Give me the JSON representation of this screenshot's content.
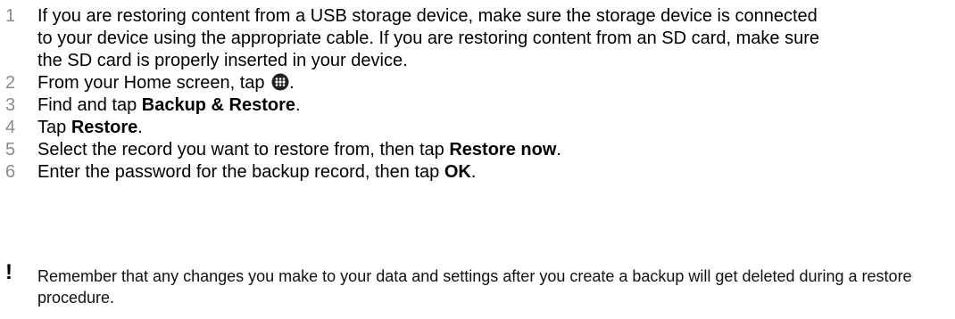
{
  "steps": [
    {
      "number": "1",
      "text": "If you are restoring content from a USB storage device, make sure the storage device is connected to your device using the appropriate cable. If you are restoring content from an SD card, make sure the SD card is properly inserted in your device."
    },
    {
      "number": "2",
      "prefix": "From your Home screen, tap ",
      "icon": "apps-grid-icon",
      "suffix": "."
    },
    {
      "number": "3",
      "prefix": "Find and tap ",
      "bold": "Backup & Restore",
      "suffix": "."
    },
    {
      "number": "4",
      "prefix": "Tap ",
      "bold": "Restore",
      "suffix": "."
    },
    {
      "number": "5",
      "prefix": "Select the record you want to restore from, then tap ",
      "bold": "Restore now",
      "suffix": "."
    },
    {
      "number": "6",
      "prefix": "Enter the password for the backup record, then tap ",
      "bold": "OK",
      "suffix": "."
    }
  ],
  "note": {
    "mark": "!",
    "text": "Remember that any changes you make to your data and settings after you create a backup will get deleted during a restore procedure."
  },
  "colors": {
    "step_number": "#8a8a8a",
    "text": "#000000",
    "icon_fill": "#222222",
    "top_cut": "#2c8c5a"
  }
}
